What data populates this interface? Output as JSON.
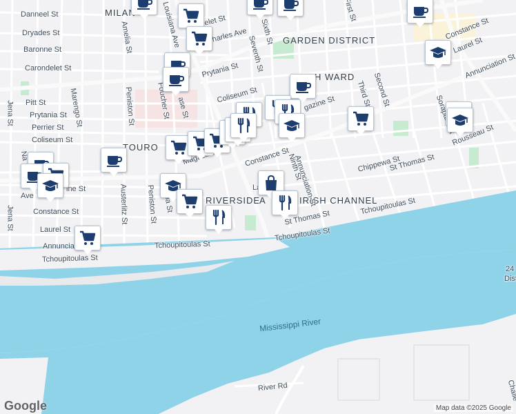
{
  "map": {
    "neighborhoods": {
      "milan": "MILAN",
      "garden_district": "GARDEN DISTRICT",
      "touro": "TOURO",
      "riverside": "RIVERSIDE",
      "irish_channel": "IRISH CHANNEL",
      "ward": "H WARD",
      "a_prefix": "A"
    },
    "water": {
      "river": "Mississippi River"
    },
    "streets": {
      "danneel": "Danneel St",
      "dryades": "Dryades St",
      "baronne": "Baronne St",
      "carondelet": "Carondelet St",
      "st_charles": "St Charles Ave",
      "pitt": "Pitt St",
      "prytania_w": "Prytania St",
      "perrier": "Perrier St",
      "coliseum_w": "Coliseum St",
      "constance_w": "Constance St",
      "laurel_w": "Laurel St",
      "annunciation_w": "Annunciat",
      "tchoupitoulas_w": "Tchoupitoulas St",
      "tchoupitoulas_c": "Tchoupitoulas St",
      "tchoupitoulas_m": "Tchoupitoulas St",
      "tchoupitoulas_e": "Tchoupitoulas St",
      "jena": "Jena St",
      "jena2": "Jena St",
      "amelia": "Amelia St",
      "marengo": "Marengo St",
      "peniston": "Peniston St",
      "peniston2": "Peniston St",
      "foucher": "Foucher St",
      "austerlitz": "Austerlitz St",
      "louisiana": "Louisiana Ave",
      "sixth": "Sixth St",
      "seventh": "Seventh St",
      "prytania_c": "Prytania St",
      "coliseum_c": "Coliseum St",
      "magazine": "Magazine St",
      "magazine2": "gazine St",
      "constance_c": "Constance St",
      "ninth": "Ninth St",
      "st_thomas_c": "St Thomas St",
      "st_thomas_e": "St Thomas St",
      "chippewa": "Chippewa St",
      "second": "Second St",
      "third": "Third St",
      "first": "First St",
      "rousseau": "Rousseau St",
      "laurel_e": "Laurel St",
      "constance_e": "Constance St",
      "annunciation_e": "Annunciation St",
      "soraparu": "Soraparu St",
      "river_rd": "River Rd",
      "annunciation_c": "Annunciation St",
      "ine": "ine St",
      "ave": "Ave",
      "na": "Na",
      "ase": "ase St",
      "elet": "elet St",
      "lia": "lia St",
      "la": "La",
      "challe": "Challe",
      "dist_24": "24",
      "dist": "Dist"
    },
    "attribution": {
      "logo": "Google",
      "text": "Map data ©2025 Google"
    }
  },
  "markers": [
    {
      "type": "coffee-icon"
    },
    {
      "type": "coffee-icon"
    },
    {
      "type": "coffee-icon"
    },
    {
      "type": "coffee-icon"
    },
    {
      "type": "grocery-cart-icon"
    },
    {
      "type": "grocery-cart-icon"
    },
    {
      "type": "coffee-icon"
    },
    {
      "type": "coffee-icon"
    },
    {
      "type": "school-icon"
    },
    {
      "type": "coffee-icon"
    },
    {
      "type": "restaurant-icon"
    },
    {
      "type": "restaurant-icon"
    },
    {
      "type": "restaurant-icon"
    },
    {
      "type": "school-icon"
    },
    {
      "type": "grocery-cart-icon"
    },
    {
      "type": "school-icon"
    },
    {
      "type": "school-icon"
    },
    {
      "type": "coffee-icon"
    },
    {
      "type": "grocery-cart-icon"
    },
    {
      "type": "grocery-cart-icon"
    },
    {
      "type": "grocery-cart-icon"
    },
    {
      "type": "restaurant-icon"
    },
    {
      "type": "restaurant-icon"
    },
    {
      "type": "restaurant-icon"
    },
    {
      "type": "coffee-icon"
    },
    {
      "type": "coffee-icon"
    },
    {
      "type": "grocery-cart-icon"
    },
    {
      "type": "school-icon"
    },
    {
      "type": "school-icon"
    },
    {
      "type": "grocery-cart-icon"
    },
    {
      "type": "restaurant-icon"
    },
    {
      "type": "grocery-cart-icon"
    },
    {
      "type": "shopping-bag-icon"
    },
    {
      "type": "restaurant-icon"
    }
  ],
  "colors": {
    "land": "#f2f2f4",
    "water": "#8fd3e8",
    "road": "#ffffff",
    "park": "#c7ebd0",
    "icon": "#1c3d6e"
  }
}
